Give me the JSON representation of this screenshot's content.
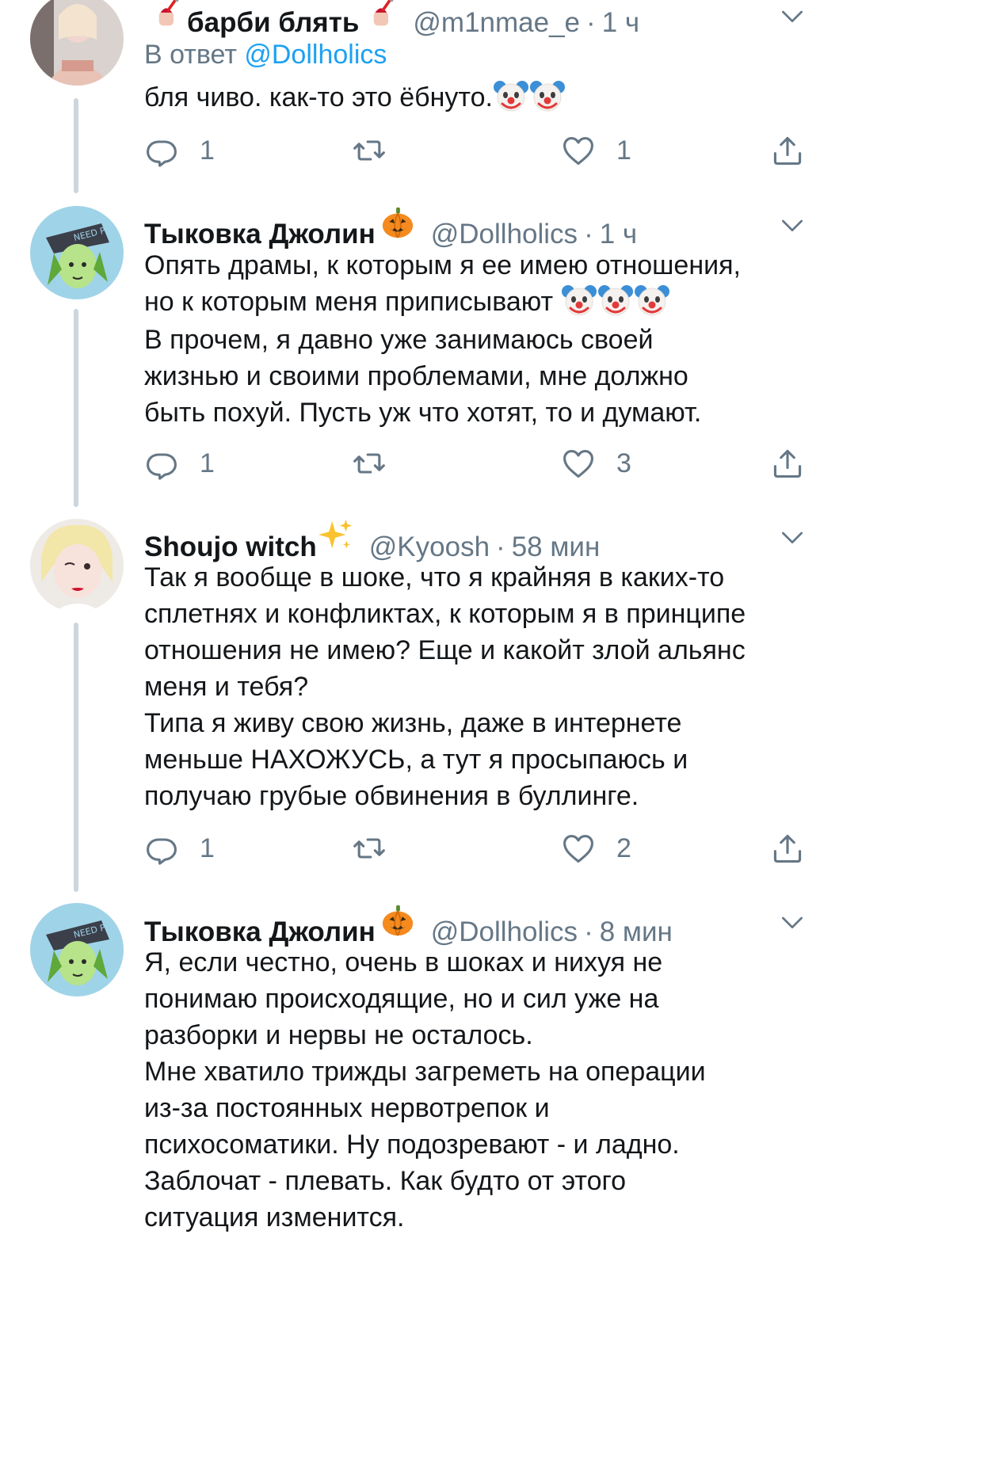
{
  "tweets": [
    {
      "name": "барби блять",
      "handle": "@m1nmae_e",
      "time": "1 ч",
      "reply_prefix": "В ответ",
      "reply_mention": "@Dollholics",
      "text_lines": [
        "бля чиво. как-то это ёбнуто."
      ],
      "replies": "1",
      "retweets": "",
      "likes": "1"
    },
    {
      "name": "Тыковка Джолин",
      "handle": "@Dollholics",
      "time": "1 ч",
      "text_lines": [
        "Опять драмы, к которым я ее имею отношения,",
        "но к которым меня приписывают",
        "В прочем, я давно уже занимаюсь своей",
        "жизнью и своими проблемами, мне должно",
        "быть похуй. Пусть уж что хотят, то и думают."
      ],
      "replies": "1",
      "retweets": "",
      "likes": "3"
    },
    {
      "name": "Shoujo witch",
      "handle": "@Kyoosh",
      "time": "58 мин",
      "text_lines": [
        "Так я вообще в шоке, что я крайняя в каких-то",
        "сплетнях и конфликтах, к которым я в принципе",
        "отношения не имею? Еще и какойт злой альянс",
        "меня и тебя?",
        "Типа я живу свою жизнь, даже в интернете",
        "меньше НАХОЖУСЬ, а тут я просыпаюсь и",
        "получаю грубые обвинения в буллинге."
      ],
      "replies": "1",
      "retweets": "",
      "likes": "2"
    },
    {
      "name": "Тыковка Джолин",
      "handle": "@Dollholics",
      "time": "8 мин",
      "text_lines": [
        "Я, если честно, очень в шоках и нихуя не",
        "понимаю происходящие, но и сил уже на",
        "разборки и нервы не осталось.",
        "Мне хватило трижды загреметь на операции",
        "из-за постоянных нервотрепок и",
        "психосоматики. Ну подозревают - и ладно.",
        "Заблочат - плевать. Как будто от этого",
        "ситуация изменится."
      ]
    }
  ],
  "colors": {
    "text": "#14171a",
    "secondary": "#657786",
    "link": "#1da1f2",
    "thread": "#ccd6dd"
  },
  "icons": [
    "reply-icon",
    "retweet-icon",
    "like-icon",
    "share-icon",
    "caret-down-icon",
    "clown-emoji",
    "pumpkin-emoji",
    "sparkles-emoji",
    "nail-polish-emoji"
  ]
}
